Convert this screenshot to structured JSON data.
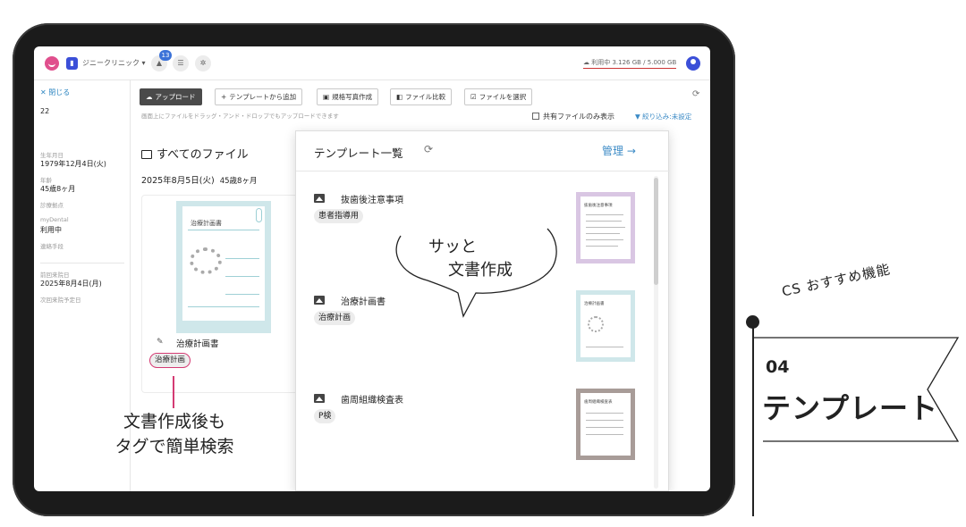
{
  "topbar": {
    "clinic_name": "ジニークリニック",
    "notification_count": "13",
    "storage": "利用中 3.126 GB / 5.000 GB"
  },
  "leftpanel": {
    "close_label": "閉じる",
    "patient_no": "22",
    "birthday_label": "生年月日",
    "birthday": "1979年12月4日(火)",
    "age_label": "年齢",
    "age": "45歳8ヶ月",
    "clinic_label": "診療拠点",
    "mydental_label": "myDental",
    "mydental_value": "利用中",
    "contact_label": "連絡手段",
    "last_visit_label": "前回来院日",
    "last_visit": "2025年8月4日(月)",
    "next_visit_label": "次回来院予定日"
  },
  "toolbar": {
    "upload": "アップロード",
    "add_template": "テンプレートから追加",
    "photo": "規格写真作成",
    "compare": "ファイル比較",
    "select": "ファイルを選択",
    "drop_hint": "画面上にファイルをドラッグ・アンド・ドロップでもアップロードできます",
    "shared_only": "共有ファイルのみ表示",
    "filter": "絞り込み:未設定"
  },
  "files": {
    "heading": "すべてのファイル",
    "date": "2025年8月5日(火)",
    "age": "45歳8ヶ月",
    "card": {
      "doc_title": "治療計画書",
      "name": "治療計画書",
      "tag": "治療計画"
    }
  },
  "popup": {
    "title": "テンプレート一覧",
    "manage": "管理",
    "templates": [
      {
        "name": "抜歯後注意事項",
        "tag": "患者指導用",
        "thumb_title": "抜歯後注意事項",
        "color": "#d9c6e3"
      },
      {
        "name": "治療計画書",
        "tag": "治療計画",
        "thumb_title": "治療計画書",
        "color": "#cfe7ea"
      },
      {
        "name": "歯周組織検査表",
        "tag": "P検",
        "thumb_title": "歯周組織検査表",
        "color": "#a89c98"
      }
    ]
  },
  "bubble": {
    "line1": "サッと",
    "line2": "文書作成"
  },
  "annotation": {
    "line1": "文書作成後も",
    "line2": "タグで簡単検索"
  },
  "feature": {
    "label": "CS おすすめ機能",
    "number": "04",
    "title": "テンプレート"
  },
  "colors": {
    "accent_pink": "#d43b73",
    "link_blue": "#3c8bc6"
  }
}
